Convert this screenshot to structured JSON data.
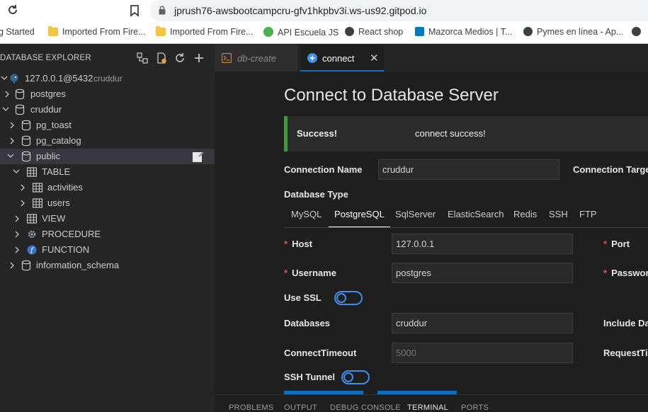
{
  "browser": {
    "url": "jprush76-awsbootcampcru-gfv1hkpbv3i.ws-us92.gitpod.io",
    "bookmarks": [
      {
        "label": "g Started",
        "icon": "none"
      },
      {
        "label": "Imported From Fire...",
        "icon": "folder-icon"
      },
      {
        "label": "Imported From Fire...",
        "icon": "folder-icon"
      },
      {
        "label": "API Escuela JS",
        "icon": "green-globe-icon"
      },
      {
        "label": "React shop",
        "icon": "globe-icon"
      },
      {
        "label": "Mazorca Medios | T...",
        "icon": "trello-icon"
      },
      {
        "label": "Pymes en línea - Ap...",
        "icon": "globe-icon"
      }
    ]
  },
  "sidebar": {
    "title": "DATABASE EXPLORER",
    "tree": {
      "connection": {
        "label": "127.0.0.1@5432",
        "detail": "cruddur"
      },
      "db_postgres": "postgres",
      "db_cruddur": "cruddur",
      "schema_pg_toast": "pg_toast",
      "schema_pg_catalog": "pg_catalog",
      "schema_public": "public",
      "group_table": "TABLE",
      "table_activities": "activities",
      "table_users": "users",
      "group_view": "VIEW",
      "group_procedure": "PROCEDURE",
      "group_function": "FUNCTION",
      "schema_information": "information_schema"
    }
  },
  "tabs": {
    "tab1": "db-create",
    "tab2": "connect",
    "close": "✕"
  },
  "form": {
    "title": "Connect to Database Server",
    "alert_title": "Success!",
    "alert_message": "connect success!",
    "connection_name_label": "Connection Name",
    "connection_name_value": "cruddur",
    "connection_target_label": "Connection Target",
    "database_type_label": "Database Type",
    "db_types": [
      "MySQL",
      "PostgreSQL",
      "SqlServer",
      "ElasticSearch",
      "Redis",
      "SSH",
      "FTP"
    ],
    "active_db_type": "PostgreSQL",
    "host_label": "Host",
    "host_value": "127.0.0.1",
    "port_label": "Port",
    "username_label": "Username",
    "username_value": "postgres",
    "password_label": "Password",
    "use_ssl_label": "Use SSL",
    "databases_label": "Databases",
    "databases_value": "cruddur",
    "include_db_label": "Include Da",
    "connect_timeout_label": "ConnectTimeout",
    "connect_timeout_placeholder": "5000",
    "request_timeout_label": "RequestTir",
    "ssh_tunnel_label": "SSH Tunnel",
    "required_mark": "*"
  },
  "panel": {
    "tabs": [
      "PROBLEMS",
      "OUTPUT",
      "DEBUG CONSOLE",
      "TERMINAL",
      "PORTS"
    ],
    "active": "TERMINAL"
  },
  "colors": {
    "accent": "#0e70c0",
    "success": "#3e9b3f",
    "required": "#f14c4c"
  }
}
